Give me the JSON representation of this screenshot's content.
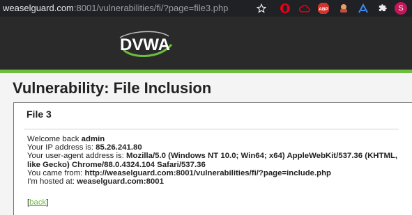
{
  "browser": {
    "url_host": "weaselguard.com",
    "url_rest": ":8001/vulnerabilities/fi/?page=file3.php",
    "profile_initial": "S",
    "extensions": [
      "star-icon",
      "opera-icon",
      "cloud-icon",
      "adblock-plus-icon",
      "extension-icon-1",
      "extension-icon-2",
      "puzzle-icon",
      "profile-avatar"
    ],
    "abp_label": "ABP"
  },
  "header": {
    "logo_text": "DVWA"
  },
  "page": {
    "title": "Vulnerability: File Inclusion",
    "box_heading": "File 3",
    "welcome_prefix": "Welcome back ",
    "username": "admin",
    "ip_prefix": "Your IP address is: ",
    "ip": "85.26.241.80",
    "ua_prefix": "Your user-agent address is: ",
    "user_agent": "Mozilla/5.0 (Windows NT 10.0; Win64; x64) AppleWebKit/537.36 (KHTML, like Gecko) Chrome/88.0.4324.104 Safari/537.36",
    "came_prefix": "You came from: ",
    "came_from": "http://weaselguard.com:8001/vulnerabilities/fi/?page=include.php",
    "hosted_prefix": "I'm hosted at: ",
    "hosted_at": "weaselguard.com:8001",
    "back_open": "[",
    "back_label": "back",
    "back_close": "]"
  },
  "colors": {
    "accent_green": "#6dbd3e",
    "header_bg": "#2a2a2a"
  }
}
